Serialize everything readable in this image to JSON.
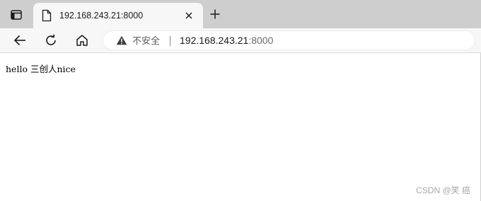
{
  "tab": {
    "title": "192.168.243.21:8000"
  },
  "toolbar": {
    "security_label": "不安全",
    "url_host": "192.168.243.21",
    "url_port": ":8000"
  },
  "page": {
    "body_text": "hello 三创人nice"
  },
  "watermark": "CSDN @笑 癌",
  "icons": [
    "tab-actions-icon",
    "page-icon",
    "close-icon",
    "plus-icon",
    "back-arrow-icon",
    "refresh-icon",
    "home-icon",
    "warning-icon"
  ]
}
